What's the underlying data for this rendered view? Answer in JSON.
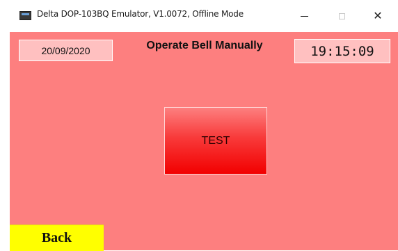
{
  "window": {
    "title": "Delta DOP-103BQ Emulator, V1.0072, Offline Mode",
    "icon": "app-icon",
    "controls": {
      "minimize_icon": "minimize-icon",
      "maximize_icon": "maximize-icon",
      "close_glyph": "✕"
    }
  },
  "screen": {
    "background": "#fd7f7f",
    "date": "20/09/2020",
    "title": "Operate Bell Manually",
    "time": "19:15:09",
    "test_label": "TEST",
    "back_label": "Back"
  },
  "colors": {
    "accent_red": "#f20000",
    "back_yellow": "#ffff00",
    "field_pink": "#ffc0c0"
  }
}
